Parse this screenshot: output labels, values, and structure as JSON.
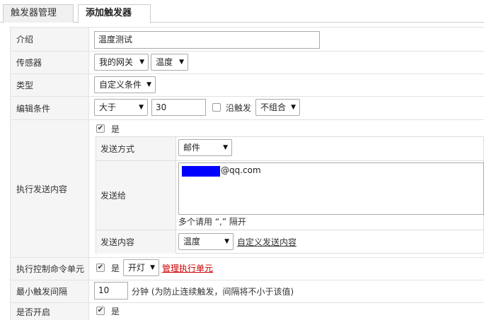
{
  "tabs": [
    {
      "label": "触发器管理"
    },
    {
      "label": "添加触发器"
    }
  ],
  "form": {
    "intro": {
      "label": "介绍",
      "value": "温度测试"
    },
    "sensor": {
      "label": "传感器",
      "gateway": "我的网关",
      "sensor": "温度"
    },
    "type": {
      "label": "类型",
      "value": "自定义条件"
    },
    "condition": {
      "label": "编辑条件",
      "operator": "大于",
      "value": "30",
      "edge_label": "沿触发",
      "edge_checked": false,
      "combine": "不组合"
    },
    "send": {
      "label": "执行发送内容",
      "enabled_label": "是",
      "enabled": true,
      "method_label": "发送方式",
      "method_value": "邮件",
      "to_label": "发送给",
      "to_value": "@qq.com",
      "to_hint": "多个请用 “,” 隔开",
      "content_label": "发送内容",
      "content_value": "温度",
      "custom_link": "自定义发送内容"
    },
    "control": {
      "label": "执行控制命令单元",
      "enabled_label": "是",
      "enabled": true,
      "command": "开灯",
      "manage_link": "管理执行单元",
      "manage_link_color": "#cc0000"
    },
    "interval": {
      "label": "最小触发间隔",
      "value": "10",
      "note": "分钟 (为防止连续触发，间隔将不小于该值)"
    },
    "enable": {
      "label": "是否开启",
      "enabled_label": "是",
      "enabled": true
    }
  },
  "icons": {
    "checked": "✔",
    "dropdown": "▼"
  }
}
